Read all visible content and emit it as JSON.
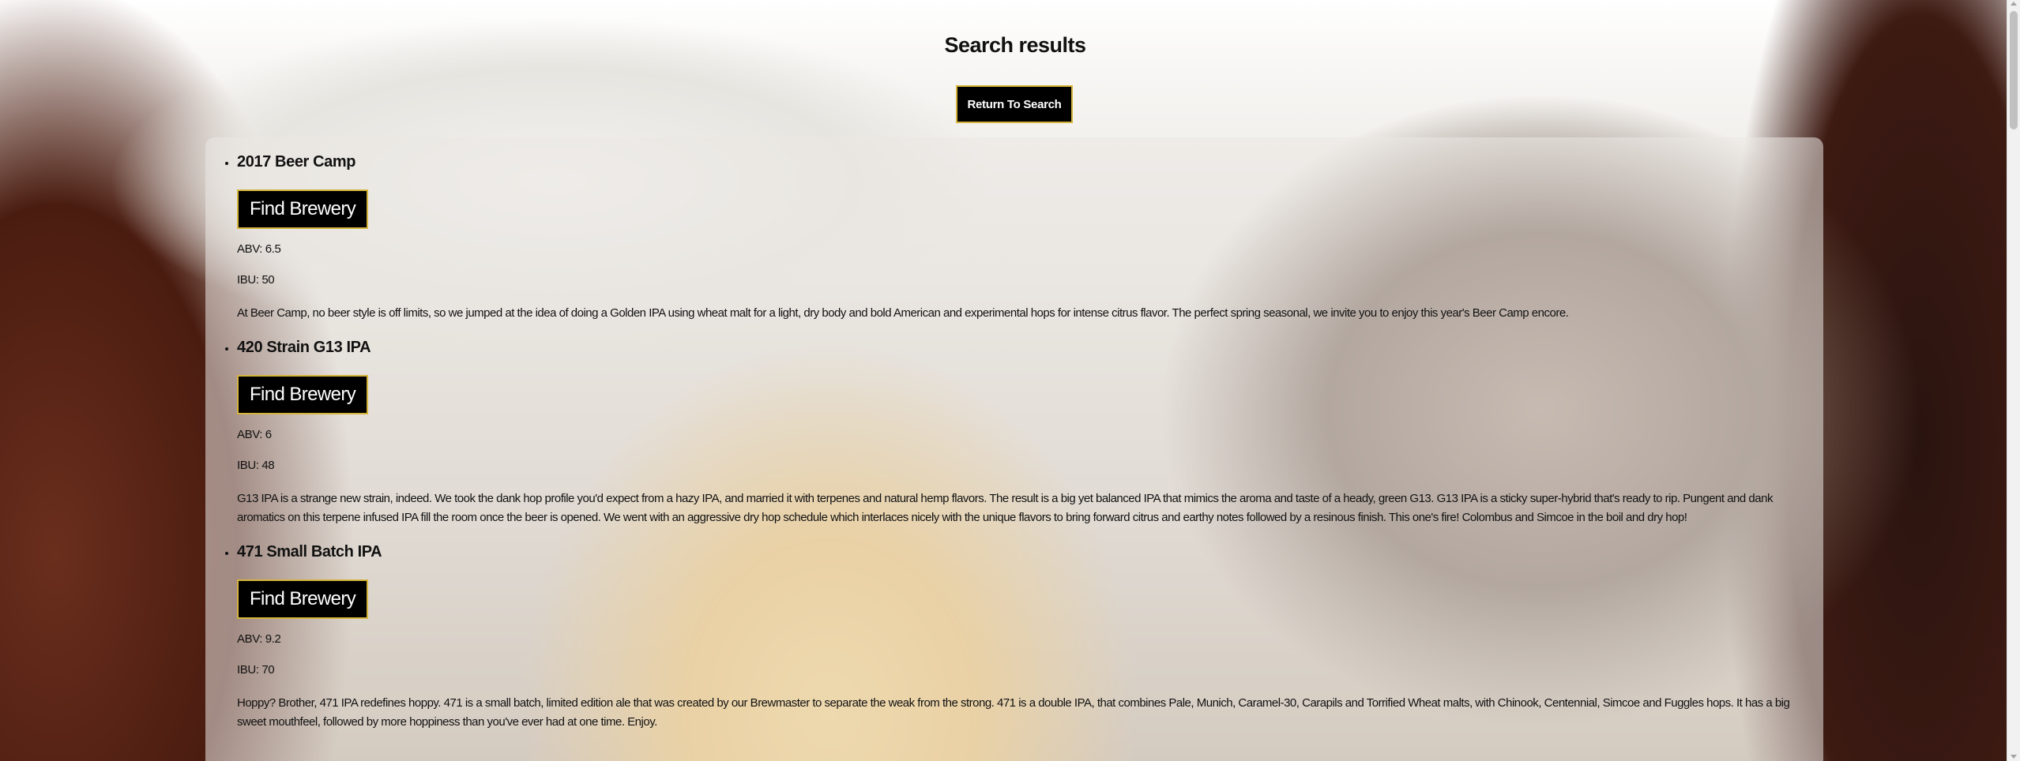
{
  "page": {
    "title": "Search results",
    "return_button_label": "Return To Search",
    "find_brewery_label": "Find Brewery"
  },
  "results": [
    {
      "name": "2017 Beer Camp",
      "abv": "ABV: 6.5",
      "ibu": "IBU: 50",
      "description": "At Beer Camp, no beer style is off limits, so we jumped at the idea of doing a Golden IPA using wheat malt for a light, dry body and bold American and experimental hops for intense citrus flavor. The perfect spring seasonal, we invite you to enjoy this year's Beer Camp encore."
    },
    {
      "name": "420 Strain G13 IPA",
      "abv": "ABV: 6",
      "ibu": "IBU: 48",
      "description": "G13 IPA is a strange new strain, indeed. We took the dank hop profile you'd expect from a hazy IPA, and married it with terpenes and natural hemp flavors. The result is a big yet balanced IPA that mimics the aroma and taste of a heady, green G13. G13 IPA is a sticky super-hybrid that's ready to rip. Pungent and dank aromatics on this terpene infused IPA fill the room once the beer is opened. We went with an aggressive dry hop schedule which interlaces nicely with the unique flavors to bring forward citrus and earthy notes followed by a resinous finish. This one's fire! Colombus and Simcoe in the boil and dry hop!"
    },
    {
      "name": "471 Small Batch IPA",
      "abv": "ABV: 9.2",
      "ibu": "IBU: 70",
      "description": "Hoppy? Brother, 471 IPA redefines hoppy. 471 is a small batch, limited edition ale that was created by our Brewmaster to separate the weak from the strong. 471 is a double IPA, that combines Pale, Munich, Caramel-30, Carapils and Torrified Wheat malts, with Chinook, Centennial, Simcoe and Fuggles hops. It has a big sweet mouthfeel, followed by more hoppiness than you've ever had at one time. Enjoy."
    }
  ]
}
